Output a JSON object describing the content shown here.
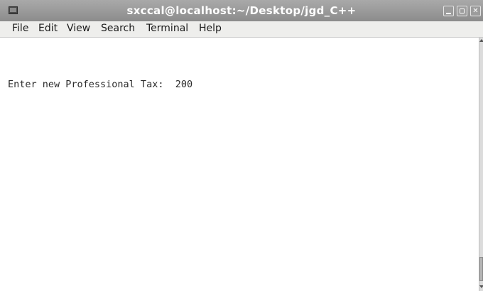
{
  "window": {
    "title": "sxccal@localhost:~/Desktop/jgd_C++"
  },
  "menu": {
    "items": [
      "File",
      "Edit",
      "View",
      "Search",
      "Terminal",
      "Help"
    ]
  },
  "terminal": {
    "lines": [
      "Enter new Professional Tax:  200"
    ]
  },
  "icons": {
    "app": "terminal-icon",
    "minimize": "minimize-icon",
    "maximize": "maximize-icon",
    "close": "close-icon"
  },
  "colors": {
    "titlebar": "#999999",
    "menubar": "#eeeeec",
    "terminal_bg": "#ffffff",
    "terminal_text": "#2b2b2b"
  }
}
